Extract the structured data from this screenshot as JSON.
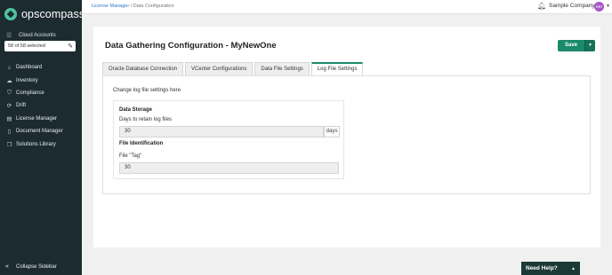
{
  "app": {
    "logo_text": "opscompass"
  },
  "sidebar": {
    "cloud_accounts_label": "Cloud Accounts",
    "account_selector_value": "58 of 58 selected",
    "items": [
      {
        "label": "Dashboard",
        "icon": "home-icon"
      },
      {
        "label": "Inventory",
        "icon": "cloud-icon"
      },
      {
        "label": "Compliance",
        "icon": "shield-icon"
      },
      {
        "label": "Drift",
        "icon": "refresh-icon"
      },
      {
        "label": "License Manager",
        "icon": "document-icon"
      },
      {
        "label": "Document Manager",
        "icon": "file-icon"
      },
      {
        "label": "Solutions Library",
        "icon": "copy-icon"
      }
    ],
    "collapse_label": "Collapse Sidebar"
  },
  "topbar": {
    "breadcrumb_link": "License Manager",
    "breadcrumb_separator": "/",
    "breadcrumb_current": "Data Configuration",
    "company": "Sample Company",
    "avatar_initials": "MH"
  },
  "page": {
    "title": "Data Gathering Configuration - MyNewOne",
    "save_label": "Save",
    "tabs": [
      {
        "label": "Oracle Database Connection"
      },
      {
        "label": "VCenter Configurations"
      },
      {
        "label": "Data File Settings"
      },
      {
        "label": "Log File Settings"
      }
    ],
    "active_tab": "Log File Settings",
    "description": "Change log file settings here",
    "data_storage": {
      "title": "Data Storage",
      "days_label": "Days to retain log files",
      "days_value": "30",
      "days_unit": "days"
    },
    "file_identification": {
      "title": "File Identification",
      "tag_label": "File \"Tag\"",
      "tag_value": "30"
    }
  },
  "help": {
    "label": "Need Help?"
  },
  "colors": {
    "sidebar_bg": "#1c2b30",
    "accent": "#1b8a6b",
    "avatar": "#a855c7",
    "link": "#2a78c2"
  }
}
